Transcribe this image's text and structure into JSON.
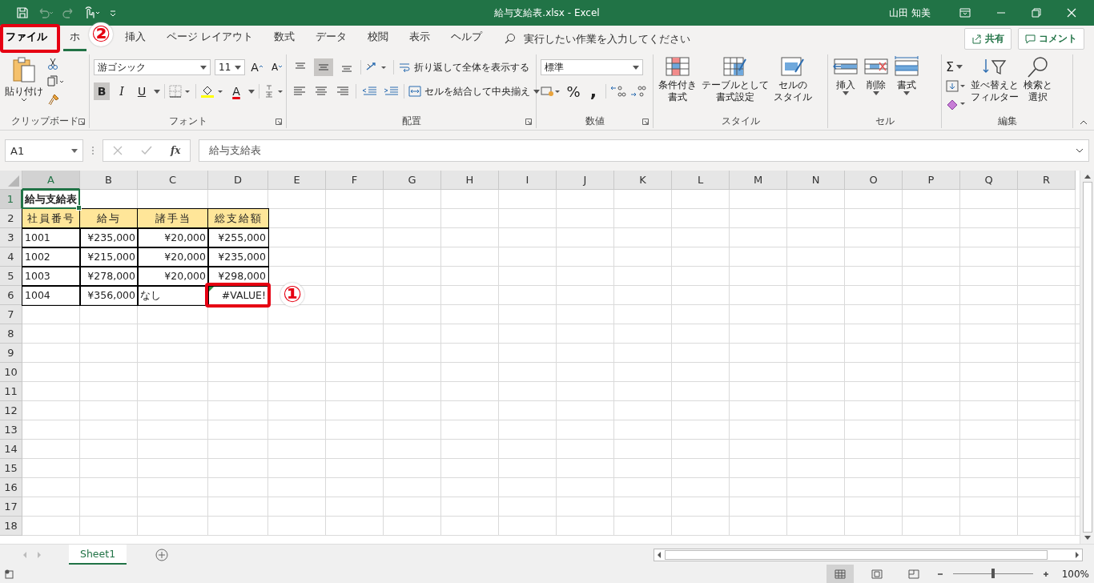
{
  "title_bar": {
    "title": "給与支給表.xlsx  -  Excel",
    "user": "山田 知美"
  },
  "tabs": [
    {
      "label": "ファイル",
      "selected": false,
      "highlighted": true
    },
    {
      "label": "ホ",
      "selected": true,
      "highlighted": false,
      "callout": "②"
    },
    {
      "label": "挿入",
      "selected": false,
      "highlighted": false
    },
    {
      "label": "ページ レイアウト",
      "selected": false,
      "highlighted": false
    },
    {
      "label": "数式",
      "selected": false,
      "highlighted": false
    },
    {
      "label": "データ",
      "selected": false,
      "highlighted": false
    },
    {
      "label": "校閲",
      "selected": false,
      "highlighted": false
    },
    {
      "label": "表示",
      "selected": false,
      "highlighted": false
    },
    {
      "label": "ヘルプ",
      "selected": false,
      "highlighted": false
    }
  ],
  "tell_me": {
    "placeholder": "実行したい作業を入力してください"
  },
  "share_button": "共有",
  "comment_button": "コメント",
  "ribbon": {
    "clipboard": {
      "title": "クリップボード",
      "paste": "貼り付け"
    },
    "font": {
      "title": "フォント",
      "font_name": "游ゴシック",
      "font_size": "11",
      "grow": "A",
      "shrink": "A",
      "bold": "B",
      "italic": "I",
      "underline": "U",
      "font_color": "A",
      "bold_on": true
    },
    "alignment": {
      "title": "配置",
      "wrap_text": "折り返して全体を表示する",
      "merge": "セルを結合して中央揃え",
      "vertical_align": [
        {
          "selected": false
        },
        {
          "selected": true
        },
        {
          "selected": false
        }
      ]
    },
    "number": {
      "title": "数値",
      "format": "標準",
      "percent": "%",
      "comma": ","
    },
    "styles": {
      "title": "スタイル",
      "buttons": [
        {
          "kind": "conditional",
          "lines": [
            "条件付き",
            "書式"
          ]
        },
        {
          "kind": "table",
          "lines": [
            "テーブルとして",
            "書式設定"
          ]
        },
        {
          "kind": "cell_styles",
          "lines": [
            "セルの",
            "スタイル"
          ]
        }
      ]
    },
    "cells": {
      "title": "セル",
      "buttons": [
        {
          "kind": "insert",
          "label": "挿入"
        },
        {
          "kind": "delete",
          "label": "削除"
        },
        {
          "kind": "format",
          "label": "書式"
        }
      ]
    },
    "editing": {
      "title": "編集",
      "sum": "Σ",
      "buttons": [
        {
          "kind": "sort",
          "lines": [
            "並べ替えと",
            "フィルター"
          ]
        },
        {
          "kind": "find",
          "lines": [
            "検索と",
            "選択"
          ]
        }
      ]
    }
  },
  "formula_bar": {
    "name_box": "A1",
    "fx": "fx",
    "content": "給与支給表"
  },
  "sheet": {
    "columns": [
      "A",
      "B",
      "C",
      "D",
      "E",
      "F",
      "G",
      "H",
      "I",
      "J",
      "K",
      "L",
      "M",
      "N",
      "O",
      "P",
      "Q",
      "R"
    ],
    "rows": [
      {
        "number": "1",
        "cells": [
          {
            "text": "給与支給表",
            "kind": "title",
            "selected": true
          }
        ]
      },
      {
        "number": "2",
        "cells": [
          {
            "text": "社員番号",
            "kind": "header",
            "selected": false
          },
          {
            "text": "給与",
            "kind": "header",
            "selected": false
          },
          {
            "text": "諸手当",
            "kind": "header",
            "selected": false
          },
          {
            "text": "総支給額",
            "kind": "header",
            "selected": false
          }
        ]
      },
      {
        "number": "3",
        "cells": [
          {
            "text": "1001",
            "kind": "text",
            "selected": false
          },
          {
            "text": "¥235,000",
            "kind": "number",
            "selected": false
          },
          {
            "text": "¥20,000",
            "kind": "number",
            "selected": false
          },
          {
            "text": "¥255,000",
            "kind": "number",
            "selected": false
          }
        ]
      },
      {
        "number": "4",
        "cells": [
          {
            "text": "1002",
            "kind": "text",
            "selected": false
          },
          {
            "text": "¥215,000",
            "kind": "number",
            "selected": false
          },
          {
            "text": "¥20,000",
            "kind": "number",
            "selected": false
          },
          {
            "text": "¥235,000",
            "kind": "number",
            "selected": false
          }
        ]
      },
      {
        "number": "5",
        "cells": [
          {
            "text": "1003",
            "kind": "text",
            "selected": false
          },
          {
            "text": "¥278,000",
            "kind": "number",
            "selected": false
          },
          {
            "text": "¥20,000",
            "kind": "number",
            "selected": false
          },
          {
            "text": "¥298,000",
            "kind": "number",
            "selected": false
          }
        ]
      },
      {
        "number": "6",
        "cells": [
          {
            "text": "1004",
            "kind": "text",
            "selected": false
          },
          {
            "text": "¥356,000",
            "kind": "number",
            "selected": false
          },
          {
            "text": "なし",
            "kind": "text",
            "selected": false
          },
          {
            "text": "#VALUE!",
            "kind": "error",
            "selected": false,
            "highlighted": true,
            "callout": "①"
          }
        ]
      },
      {
        "number": "7"
      },
      {
        "number": "8"
      },
      {
        "number": "9"
      },
      {
        "number": "10"
      },
      {
        "number": "11"
      },
      {
        "number": "12"
      },
      {
        "number": "13"
      },
      {
        "number": "14"
      },
      {
        "number": "15"
      },
      {
        "number": "16"
      },
      {
        "number": "17"
      },
      {
        "number": "18"
      }
    ]
  },
  "sheet_tabs": [
    {
      "label": "Sheet1",
      "selected": true
    }
  ],
  "status_bar": {
    "views": [
      {
        "selected": true
      },
      {
        "selected": false
      },
      {
        "selected": false
      }
    ],
    "zoom": {
      "level": 0.5
    },
    "zoom_text": "100%"
  }
}
